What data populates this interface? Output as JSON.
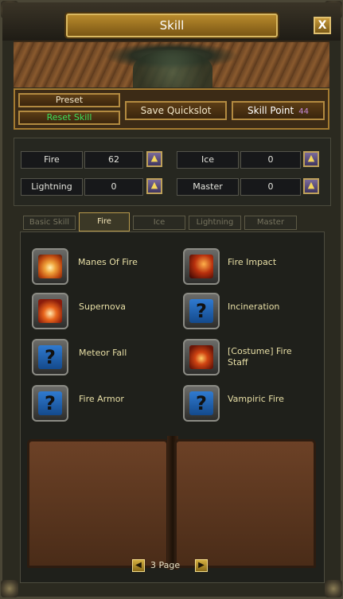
{
  "window": {
    "title": "Skill",
    "close_label": "X"
  },
  "controls": {
    "preset_label": "Preset",
    "reset_label": "Reset Skill",
    "save_quickslot_label": "Save Quickslot",
    "skill_point_label": "Skill Point",
    "skill_point_value": "44"
  },
  "stats": [
    {
      "label": "Fire",
      "value": "62"
    },
    {
      "label": "Ice",
      "value": "0"
    },
    {
      "label": "Lightning",
      "value": "0"
    },
    {
      "label": "Master",
      "value": "0"
    }
  ],
  "tabs": [
    {
      "label": "Basic Skill",
      "active": false
    },
    {
      "label": "Fire",
      "active": true
    },
    {
      "label": "Ice",
      "active": false
    },
    {
      "label": "Lightning",
      "active": false
    },
    {
      "label": "Master",
      "active": false
    }
  ],
  "skills": [
    {
      "name": "Manes Of Fire",
      "icon": "flame-burst-icon"
    },
    {
      "name": "Fire Impact",
      "icon": "fire-impact-icon"
    },
    {
      "name": "Supernova",
      "icon": "supernova-icon"
    },
    {
      "name": "Incineration",
      "icon": "unknown-skill-icon"
    },
    {
      "name": "Meteor Fall",
      "icon": "unknown-skill-icon"
    },
    {
      "name": "[Costume] Fire Staff",
      "icon": "fire-staff-icon"
    },
    {
      "name": "Fire Armor",
      "icon": "unknown-skill-icon"
    },
    {
      "name": "Vampiric Fire",
      "icon": "unknown-skill-icon"
    }
  ],
  "unknown_icon_glyph": "?",
  "plus_glyph": "▲",
  "pager": {
    "prev_glyph": "◀",
    "next_glyph": "▶",
    "page_label": "3 Page"
  }
}
